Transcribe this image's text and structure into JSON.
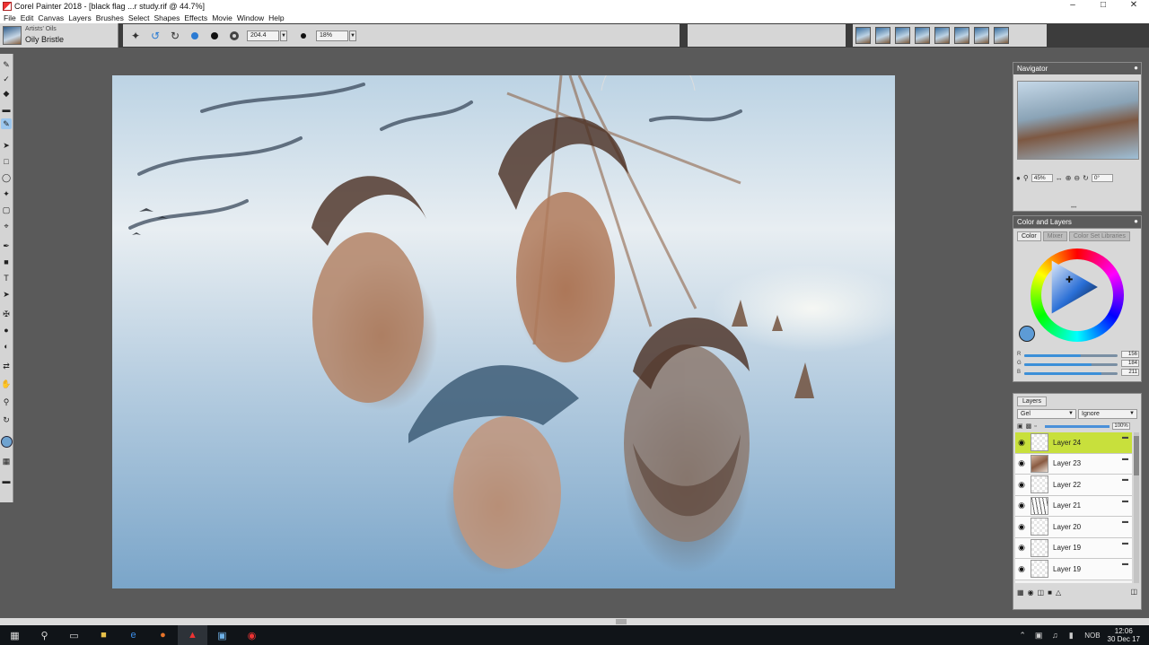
{
  "window": {
    "title": "Corel Painter 2018 - [black flag ...r study.rif @ 44.7%]",
    "controls": [
      "–",
      "□",
      "✕"
    ]
  },
  "menu": [
    "File",
    "Edit",
    "Canvas",
    "Layers",
    "Brushes",
    "Select",
    "Shapes",
    "Effects",
    "Movie",
    "Window",
    "Help"
  ],
  "brush": {
    "category": "Artists' Oils",
    "variant": "Oily Bristle"
  },
  "property_bar": {
    "size_value": "204.4",
    "opacity_value": "18%"
  },
  "navigator": {
    "title": "Navigator",
    "zoom_value": "45%",
    "rotation_value": "0°"
  },
  "color_panel": {
    "title": "Color and Layers",
    "tabs": [
      "Color",
      "Mixer",
      "Color Set Libraries"
    ],
    "rgb": [
      {
        "label": "R",
        "value": "156",
        "fraction": 0.61
      },
      {
        "label": "G",
        "value": "184",
        "fraction": 0.72
      },
      {
        "label": "B",
        "value": "211",
        "fraction": 0.83
      }
    ],
    "current_color": "#5d9bd6"
  },
  "layers_panel": {
    "tab": "Layers",
    "composite_method": "Gel",
    "composite_depth": "Ignore",
    "opacity_value": "100%",
    "layers": [
      {
        "name": "Layer 24",
        "selected": true,
        "thumb": "blank"
      },
      {
        "name": "Layer 23",
        "selected": false,
        "thumb": "painted"
      },
      {
        "name": "Layer 22",
        "selected": false,
        "thumb": "blank"
      },
      {
        "name": "Layer 21",
        "selected": false,
        "thumb": "sketch"
      },
      {
        "name": "Layer 20",
        "selected": false,
        "thumb": "blank"
      },
      {
        "name": "Layer 19",
        "selected": false,
        "thumb": "blank"
      },
      {
        "name": "Layer 19",
        "selected": false,
        "thumb": "blank"
      }
    ],
    "selected_color": "#c8e03c"
  },
  "taskbar": {
    "language": "NOB",
    "time": "12:06",
    "date": "30 Dec 17"
  }
}
